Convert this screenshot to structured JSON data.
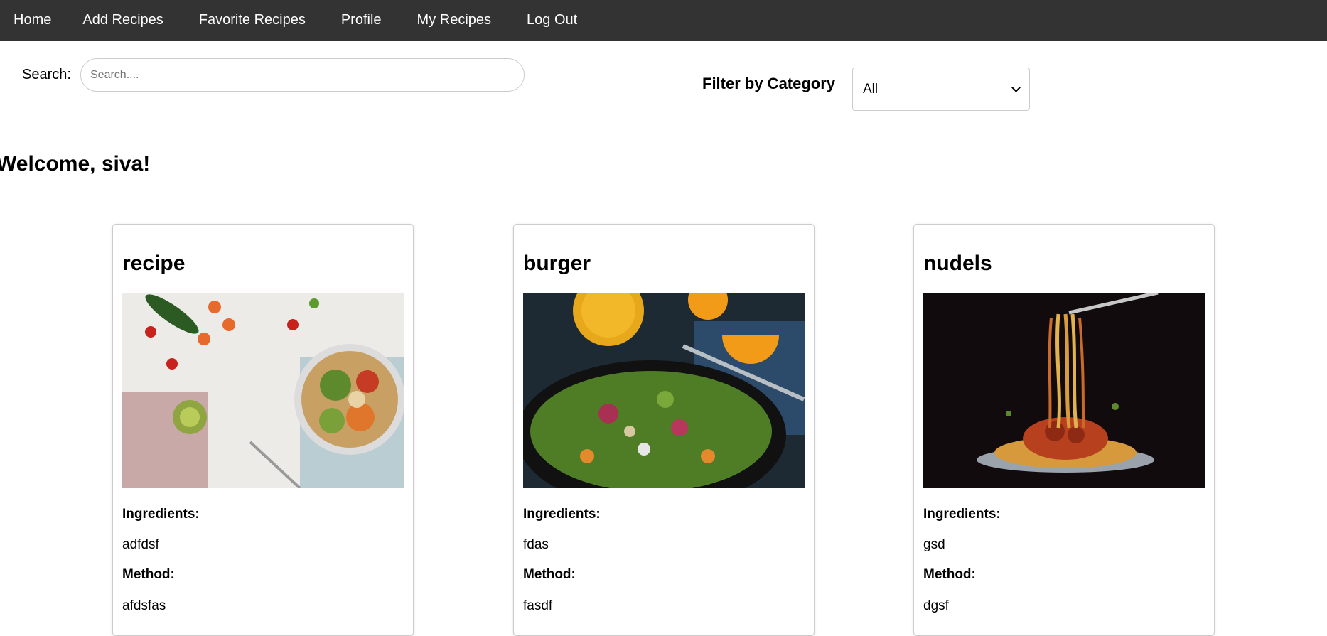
{
  "nav": {
    "items": [
      {
        "label": "Home"
      },
      {
        "label": "Add Recipes"
      },
      {
        "label": "Favorite Recipes"
      },
      {
        "label": "Profile"
      },
      {
        "label": "My Recipes"
      },
      {
        "label": "Log Out"
      }
    ]
  },
  "search": {
    "label": "Search:",
    "placeholder": "Search....",
    "value": ""
  },
  "filter": {
    "label": "Filter by Category",
    "selected": "All"
  },
  "welcome": "Welcome, siva!",
  "recipes": [
    {
      "title": "recipe",
      "image_icon": "salad-bowl-image",
      "ingredients_label": "Ingredients:",
      "ingredients": "adfdsf",
      "method_label": "Method:",
      "method": "afdsfas"
    },
    {
      "title": "burger",
      "image_icon": "salad-plate-image",
      "ingredients_label": "Ingredients:",
      "ingredients": "fdas",
      "method_label": "Method:",
      "method": "fasdf"
    },
    {
      "title": "nudels",
      "image_icon": "spaghetti-image",
      "ingredients_label": "Ingredients:",
      "ingredients": "gsd",
      "method_label": "Method:",
      "method": "dgsf"
    }
  ],
  "colors": {
    "navbar_bg": "#333333",
    "navbar_text": "#ffffff",
    "border": "#cccccc"
  }
}
